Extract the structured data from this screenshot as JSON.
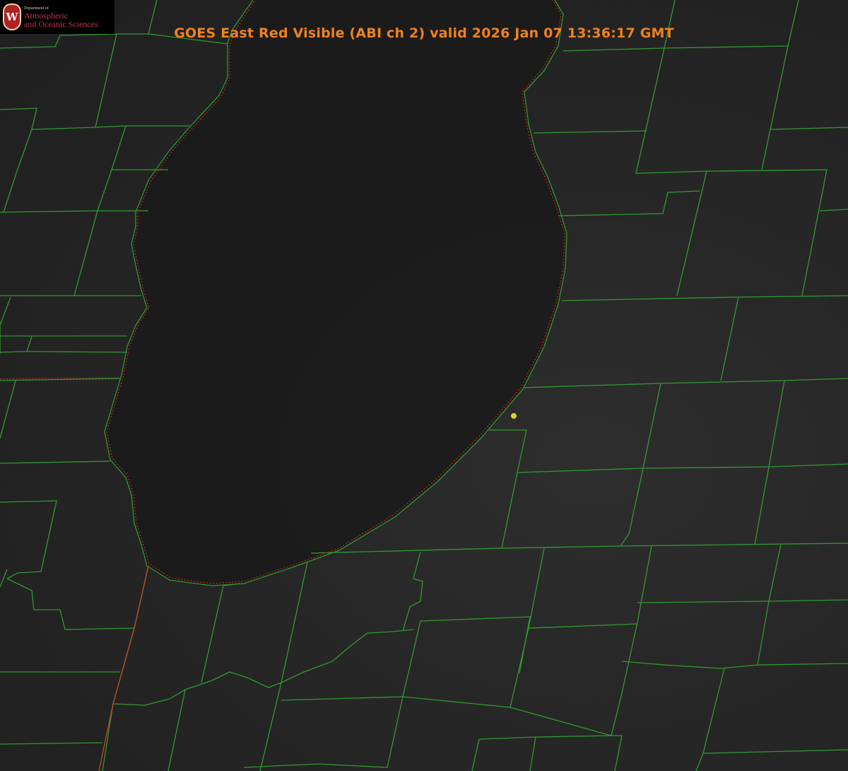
{
  "title": "GOES East Red Visible (ABI ch 2) valid 2026 Jan 07 13:36:17 GMT",
  "logo": {
    "department": "Department of",
    "line1": "Atmospheric",
    "line2": "and Oceanic Sciences",
    "seal_letter": "W"
  },
  "colors": {
    "title": "#f0821e",
    "county_lines": "#2f9a2f",
    "coastline": "#d02424",
    "marker": "#e0d12e"
  },
  "map": {
    "product": "visible satellite imagery",
    "overlays": [
      "county-boundaries",
      "coastline",
      "location-marker"
    ]
  }
}
